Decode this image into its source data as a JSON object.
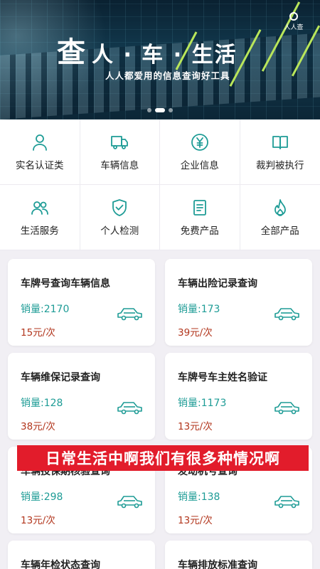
{
  "banner": {
    "logo_char": "查",
    "title": "人 · 车 · 生活",
    "subtitle": "人人都爱用的信息查询好工具",
    "brand_text": "人人查",
    "accent_color": "#b9e65a"
  },
  "categories": [
    {
      "label": "实名认证类",
      "icon": "person-icon"
    },
    {
      "label": "车辆信息",
      "icon": "truck-icon"
    },
    {
      "label": "企业信息",
      "icon": "yen-coin-icon"
    },
    {
      "label": "裁判被执行",
      "icon": "book-icon"
    },
    {
      "label": "生活服务",
      "icon": "people-icon"
    },
    {
      "label": "个人检测",
      "icon": "shield-check-icon"
    },
    {
      "label": "免费产品",
      "icon": "document-icon"
    },
    {
      "label": "全部产品",
      "icon": "flame-icon"
    }
  ],
  "products": [
    {
      "name": "车牌号查询车辆信息",
      "sales": "销量:2170",
      "price": "15元/次"
    },
    {
      "name": "车辆出险记录查询",
      "sales": "销量:173",
      "price": "39元/次"
    },
    {
      "name": "车辆维保记录查询",
      "sales": "销量:128",
      "price": "38元/次"
    },
    {
      "name": "车牌号车主姓名验证",
      "sales": "销量:1173",
      "price": "13元/次"
    },
    {
      "name": "车辆投保期核验查询",
      "sales": "销量:298",
      "price": "13元/次"
    },
    {
      "name": "发动机号查询",
      "sales": "销量:138",
      "price": "13元/次"
    },
    {
      "name": "车辆年检状态查询",
      "sales": "",
      "price": ""
    },
    {
      "name": "车辆排放标准查询",
      "sales": "",
      "price": ""
    }
  ],
  "caption": "日常生活中啊我们有很多种情况啊",
  "colors": {
    "icon": "#1e9c96",
    "sales": "#1e9c96",
    "price": "#b2361d",
    "caption_bg": "#e21c2b"
  }
}
